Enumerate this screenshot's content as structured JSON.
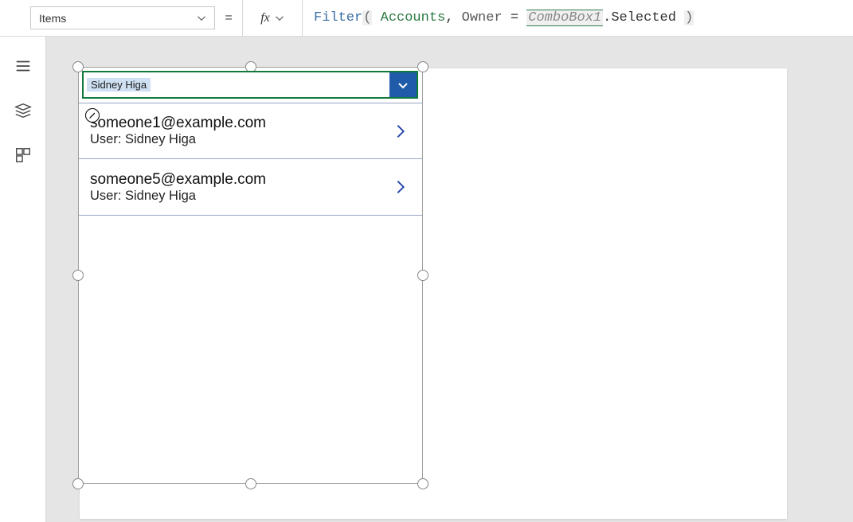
{
  "formulaBar": {
    "property": "Items",
    "equals": "=",
    "fx": "fx",
    "tokens": {
      "fn": "Filter",
      "open": "(",
      "table": "Accounts",
      "comma": ",",
      "field": "Owner",
      "op": "=",
      "control": "ComboBox1",
      "dot": ".",
      "prop": "Selected",
      "close": ")"
    }
  },
  "combobox": {
    "selected": "Sidney Higa"
  },
  "rows": [
    {
      "primary": "someone1@example.com",
      "secondary": "User: Sidney Higa"
    },
    {
      "primary": "someone5@example.com",
      "secondary": "User: Sidney Higa"
    }
  ]
}
